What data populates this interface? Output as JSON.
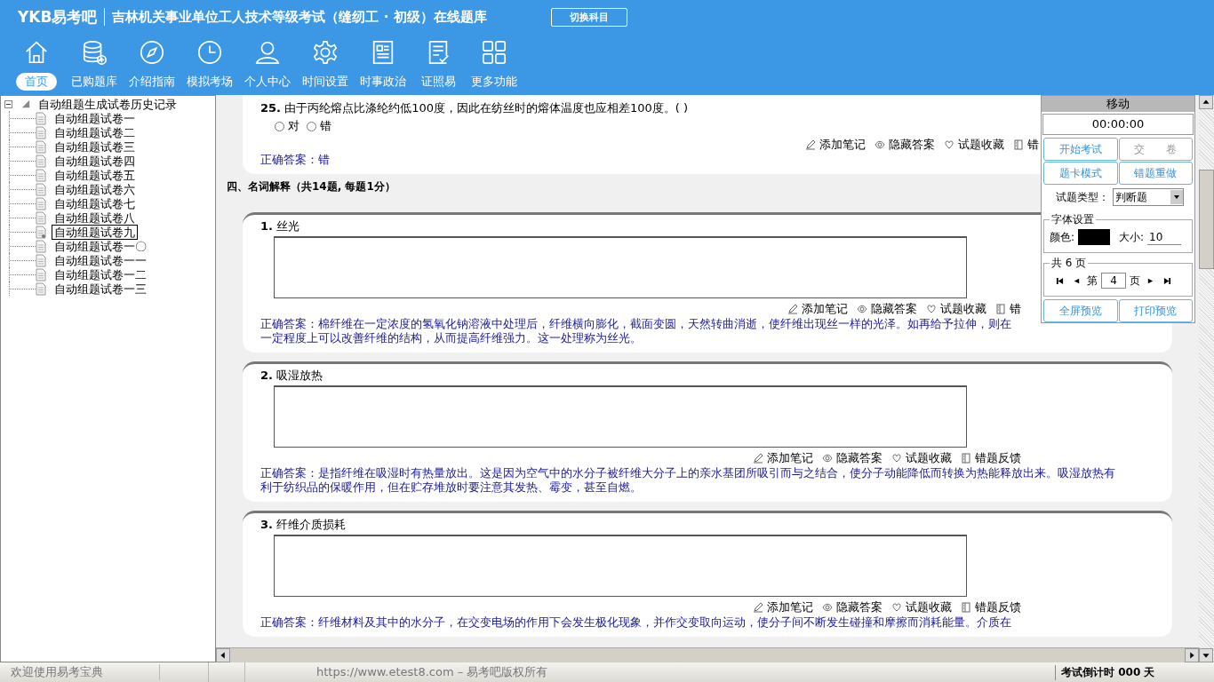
{
  "header": {
    "logo": "YKB易考吧",
    "title": "吉林机关事业单位工人技术等级考试（缝纫工 · 初级）在线题库",
    "switch_button": "切换科目"
  },
  "nav": [
    {
      "kind": "home",
      "label": "首页",
      "selected": true
    },
    {
      "kind": "database",
      "label": "已购题库",
      "selected": false
    },
    {
      "kind": "compass",
      "label": "介绍指南",
      "selected": false
    },
    {
      "kind": "clock",
      "label": "模拟考场",
      "selected": false
    },
    {
      "kind": "person",
      "label": "个人中心",
      "selected": false
    },
    {
      "kind": "gear",
      "label": "时间设置",
      "selected": false
    },
    {
      "kind": "news",
      "label": "时事政治",
      "selected": false
    },
    {
      "kind": "checklist",
      "label": "证照易",
      "selected": false
    },
    {
      "kind": "grid",
      "label": "更多功能",
      "selected": false
    }
  ],
  "tree": {
    "label": "自动组题生成试卷历史记录",
    "expanded": true,
    "children": [
      {
        "label": "自动组题试卷一",
        "selected": false
      },
      {
        "label": "自动组题试卷二",
        "selected": false
      },
      {
        "label": "自动组题试卷三",
        "selected": false
      },
      {
        "label": "自动组题试卷四",
        "selected": false
      },
      {
        "label": "自动组题试卷五",
        "selected": false
      },
      {
        "label": "自动组题试卷六",
        "selected": false
      },
      {
        "label": "自动组题试卷七",
        "selected": false
      },
      {
        "label": "自动组题试卷八",
        "selected": false
      },
      {
        "label": "自动组题试卷九",
        "selected": true
      },
      {
        "label": "自动组题试卷一〇",
        "selected": false
      },
      {
        "label": "自动组题试卷一一",
        "selected": false
      },
      {
        "label": "自动组题试卷一二",
        "selected": false
      },
      {
        "label": "自动组题试卷一三",
        "selected": false
      }
    ]
  },
  "judge_question": {
    "number": "25.",
    "text": "由于丙纶熔点比涤纶约低100度，因此在纺丝时的熔体温度也应相差100度。( )",
    "options": [
      {
        "label": "对",
        "selected": false
      },
      {
        "label": "错",
        "selected": false
      }
    ],
    "actions": [
      {
        "kind": "note",
        "label": "添加笔记"
      },
      {
        "kind": "eye",
        "label": "隐藏答案"
      },
      {
        "kind": "heart",
        "label": "试题收藏"
      },
      {
        "kind": "book",
        "label": "错"
      }
    ],
    "answer_label": "正确答案：",
    "answer": "错"
  },
  "section_heading": "四、名词解释（共14题, 每题1分）",
  "questions": [
    {
      "number": "1.",
      "title": "丝光",
      "actions": [
        {
          "kind": "note",
          "label": "添加笔记"
        },
        {
          "kind": "eye",
          "label": "隐藏答案"
        },
        {
          "kind": "heart",
          "label": "试题收藏"
        },
        {
          "kind": "book",
          "label": "错"
        }
      ],
      "answer_label": "正确答案：",
      "answer": "棉纤维在一定浓度的氢氧化钠溶液中处理后，纤维横向膨化，截面变圆，天然转曲消逝，使纤维出现丝一样的光泽。如再给予拉伸，则在一定程度上可以改善纤维的结构，从而提高纤维强力。这一处理称为丝光。"
    },
    {
      "number": "2.",
      "title": "吸湿放热",
      "actions": [
        {
          "kind": "note",
          "label": "添加笔记"
        },
        {
          "kind": "eye",
          "label": "隐藏答案"
        },
        {
          "kind": "heart",
          "label": "试题收藏"
        },
        {
          "kind": "book",
          "label": "错题反馈"
        }
      ],
      "answer_label": "正确答案：",
      "answer": "是指纤维在吸湿时有热量放出。这是因为空气中的水分子被纤维大分子上的亲水基团所吸引而与之结合，使分子动能降低而转换为热能释放出来。吸湿放热有利于纺织品的保暖作用，但在贮存堆放时要注意其发热、霉变，甚至自燃。"
    },
    {
      "number": "3.",
      "title": "纤维介质损耗",
      "actions": [
        {
          "kind": "note",
          "label": "添加笔记"
        },
        {
          "kind": "eye",
          "label": "隐藏答案"
        },
        {
          "kind": "heart",
          "label": "试题收藏"
        },
        {
          "kind": "book",
          "label": "错题反馈"
        }
      ],
      "answer_label": "正确答案：",
      "answer": "纤维材料及其中的水分子，在交变电场的作用下会发生极化现象，并作交变取向运动，使分子间不断发生碰撞和摩擦而消耗能量。介质在"
    }
  ],
  "panel": {
    "title": "移动",
    "timer": "00:00:00",
    "buttons": [
      {
        "label": "开始考试",
        "disabled": false
      },
      {
        "label": "交　　卷",
        "disabled": true
      },
      {
        "label": "题卡模式",
        "disabled": false
      },
      {
        "label": "错题重做",
        "disabled": false
      }
    ],
    "type_label": "试题类型：",
    "type_value": "判断题",
    "font_group": "字体设置",
    "color_label": "颜色:",
    "color": "#000000",
    "size_label": "大小:",
    "size": "10",
    "pager_group": "共 6 页",
    "page_prefix": "第",
    "page": "4",
    "page_suffix": "页",
    "bottom_buttons": [
      "全屏预览",
      "打印预览"
    ]
  },
  "status_bar": {
    "welcome": "欢迎使用易考宝典",
    "copyright": "https://www.etest8.com – 易考吧版权所有",
    "countdown": "考试倒计时 000 天"
  }
}
